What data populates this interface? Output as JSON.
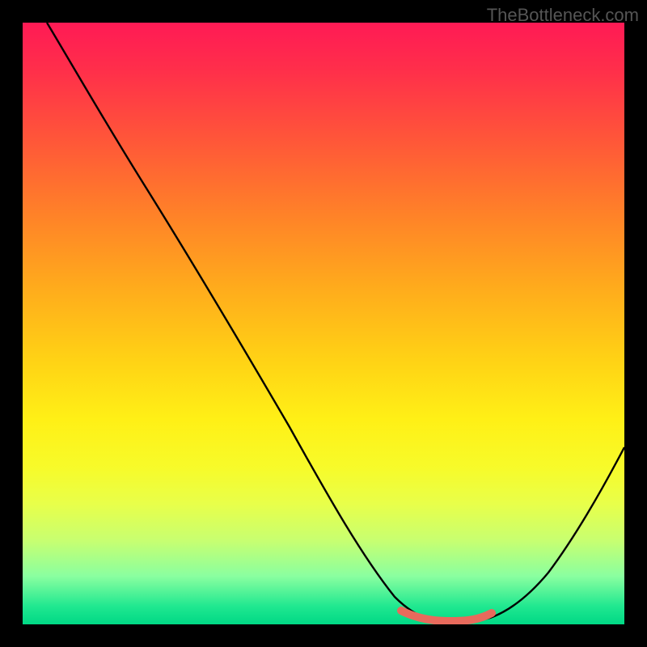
{
  "watermark": "TheBottleneck.com",
  "chart_data": {
    "type": "line",
    "title": "",
    "xlabel": "",
    "ylabel": "",
    "xlim": [
      0,
      100
    ],
    "ylim": [
      0,
      100
    ],
    "grid": false,
    "legend": false,
    "background_gradient": {
      "stops": [
        {
          "pos": 0,
          "color": "#ff1a55"
        },
        {
          "pos": 0.2,
          "color": "#ff5838"
        },
        {
          "pos": 0.44,
          "color": "#ffab1c"
        },
        {
          "pos": 0.66,
          "color": "#fff016"
        },
        {
          "pos": 0.86,
          "color": "#c8ff70"
        },
        {
          "pos": 1.0,
          "color": "#00d885"
        }
      ]
    },
    "series": [
      {
        "name": "bottleneck-curve",
        "x": [
          4,
          10,
          20,
          30,
          40,
          50,
          56,
          60,
          64,
          68,
          72,
          76,
          80,
          86,
          92,
          100
        ],
        "y": [
          100,
          91,
          76,
          61,
          46,
          30,
          20,
          12,
          5,
          1,
          0,
          0,
          2,
          9,
          20,
          37
        ],
        "color": "#000000"
      },
      {
        "name": "optimal-range-highlight",
        "x": [
          64,
          68,
          72,
          76,
          79
        ],
        "y": [
          2.5,
          1,
          0.5,
          0.8,
          2
        ],
        "color": "#e86a5c"
      }
    ],
    "annotations": []
  }
}
